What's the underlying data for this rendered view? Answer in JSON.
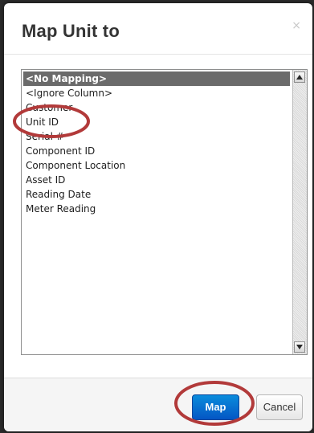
{
  "dialog": {
    "title": "Map Unit to",
    "close_label": "×"
  },
  "mapping_list": {
    "items": [
      "<No Mapping>",
      "<Ignore Column>",
      "Customer",
      "Unit ID",
      "Serial #",
      "Component ID",
      "Component Location",
      "Asset ID",
      "Reading Date",
      "Meter Reading"
    ],
    "selected_index": 0
  },
  "footer": {
    "map_label": "Map",
    "cancel_label": "Cancel"
  },
  "colors": {
    "annotation_circle": "#b23a3a",
    "primary_button": "#0a70d0",
    "selection": "#6b6b6b"
  },
  "icons": {
    "scroll_up": "triangle-up-icon",
    "scroll_down": "triangle-down-icon"
  }
}
